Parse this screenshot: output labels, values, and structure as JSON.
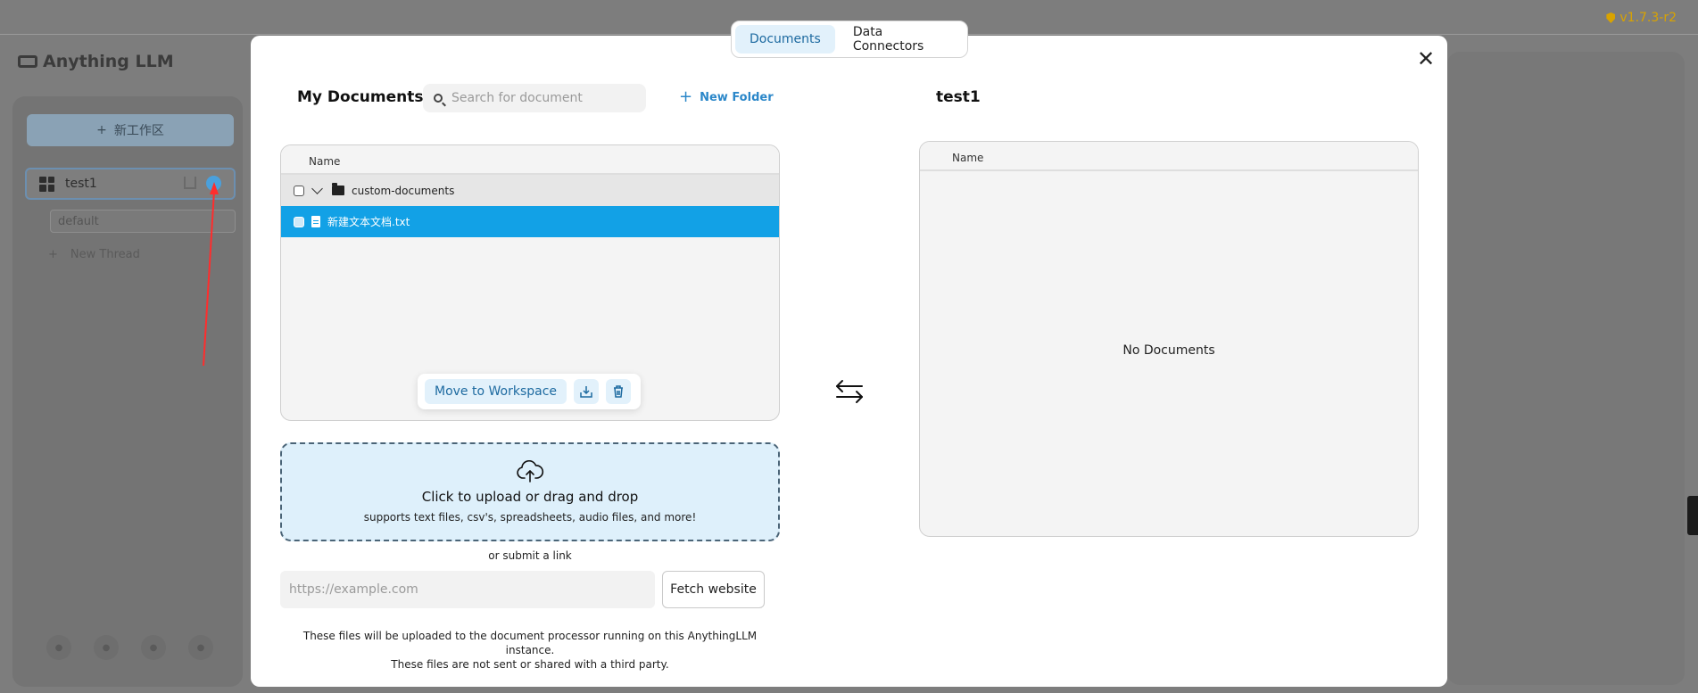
{
  "background": {
    "version": "v1.7.3-r2",
    "app_name": "Anything LLM",
    "new_workspace_label": "新工作区",
    "workspace_name": "test1",
    "thread_default": "default",
    "new_thread_label": "New Thread"
  },
  "tabs": [
    {
      "label": "Documents",
      "active": true
    },
    {
      "label": "Data Connectors",
      "active": false
    }
  ],
  "my_documents": {
    "title": "My Documents",
    "search_placeholder": "Search for document",
    "new_folder_label": "New Folder",
    "column_name": "Name",
    "rows": [
      {
        "type": "folder",
        "name": "custom-documents",
        "expanded": true,
        "selected": false
      },
      {
        "type": "file",
        "name": "新建文本文档.txt",
        "selected": true
      }
    ],
    "actions": {
      "move_label": "Move to Workspace",
      "download_icon": "download-tray-icon",
      "delete_icon": "trash-icon"
    }
  },
  "upload": {
    "title": "Click to upload or drag and drop",
    "subtitle": "supports text files, csv's, spreadsheets, audio files, and more!",
    "or_link": "or submit a link",
    "url_placeholder": "https://example.com",
    "fetch_label": "Fetch website",
    "disclaimer_line1": "These files will be uploaded to the document processor running on this AnythingLLM instance.",
    "disclaimer_line2": "These files are not sent or shared with a third party."
  },
  "workspace_docs": {
    "title": "test1",
    "column_name": "Name",
    "empty_text": "No Documents"
  },
  "colors": {
    "accent": "#12a1e6",
    "tab_active_bg": "#e2f1fb",
    "upload_bg": "#def0fb",
    "version": "#d9a300",
    "annotation_arrow": "#ff2d2d"
  }
}
